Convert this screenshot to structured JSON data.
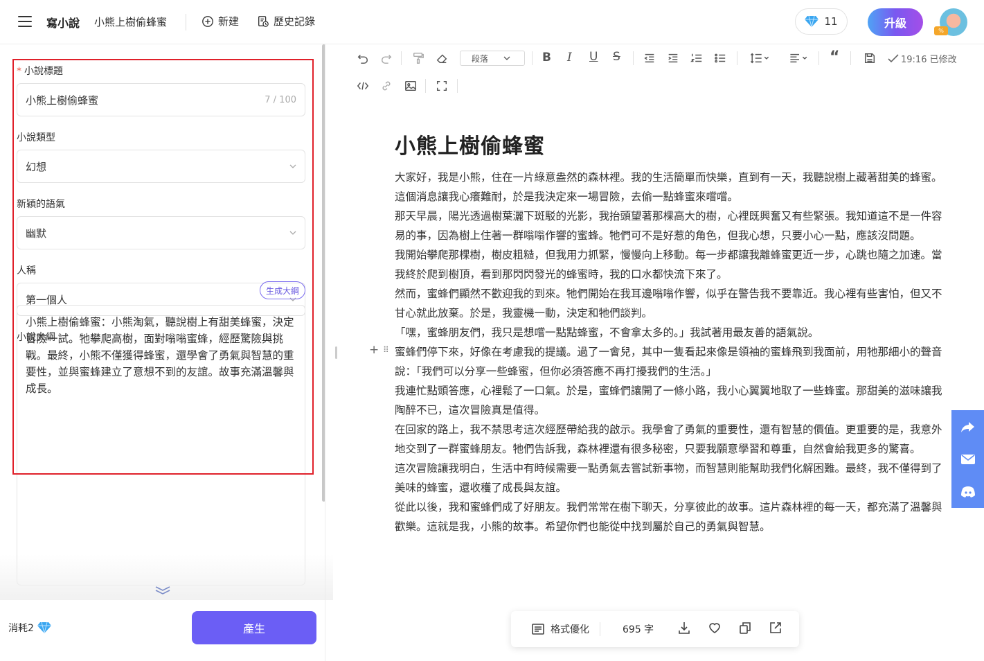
{
  "topbar": {
    "app_title": "寫小說",
    "doc_name": "小熊上樹偷蜂蜜",
    "new_label": "新建",
    "history_label": "歷史記錄",
    "gem_count": "11",
    "upgrade_label": "升級",
    "avatar_badge": "%"
  },
  "form": {
    "title_label": "小說標題",
    "title_value": "小熊上樹偷蜂蜜",
    "title_counter": "7 / 100",
    "genre_label": "小說類型",
    "genre_value": "幻想",
    "tone_label": "新穎的語氣",
    "tone_value": "幽默",
    "pov_label": "人稱",
    "pov_value": "第一個人",
    "outline_label": "小說大綱",
    "outline_button": "生成大綱",
    "outline_text": "小熊上樹偷蜂蜜：小熊淘氣，聽說樹上有甜美蜂蜜，決定冒險一試。牠攀爬高樹，面對嗡嗡蜜蜂，經歷驚險與挑戰。最終，小熊不僅獲得蜂蜜，還學會了勇氣與智慧的重要性，並與蜜蜂建立了意想不到的友誼。故事充滿溫馨與成長。",
    "cost_label": "消耗2",
    "generate_label": "產生"
  },
  "toolbar": {
    "paragraph_select": "段落",
    "saved_status": "19:16 已修改"
  },
  "document": {
    "title": "小熊上樹偷蜂蜜",
    "paragraphs": [
      "大家好，我是小熊，住在一片綠意盎然的森林裡。我的生活簡單而快樂，直到有一天，我聽說樹上藏著甜美的蜂蜜。這個消息讓我心癢難耐，於是我決定來一場冒險，去偷一點蜂蜜來嚐嚐。",
      "那天早晨，陽光透過樹葉灑下斑駁的光影，我抬頭望著那棵高大的樹，心裡既興奮又有些緊張。我知道這不是一件容易的事，因為樹上住著一群嗡嗡作響的蜜蜂。牠們可不是好惹的角色，但我心想，只要小心一點，應該沒問題。",
      "我開始攀爬那棵樹，樹皮粗糙，但我用力抓緊，慢慢向上移動。每一步都讓我離蜂蜜更近一步，心跳也隨之加速。當我終於爬到樹頂，看到那閃閃發光的蜂蜜時，我的口水都快流下來了。",
      "然而，蜜蜂們顯然不歡迎我的到來。牠們開始在我耳邊嗡嗡作響，似乎在警告我不要靠近。我心裡有些害怕，但又不甘心就此放棄。於是，我靈機一動，決定和牠們談判。",
      "「嘿，蜜蜂朋友們，我只是想嚐一點點蜂蜜，不會拿太多的。」我試著用最友善的語氣說。",
      "蜜蜂們停下來，好像在考慮我的提議。過了一會兒，其中一隻看起來像是領袖的蜜蜂飛到我面前，用牠那細小的聲音說：「我們可以分享一些蜂蜜，但你必須答應不再打擾我們的生活。」",
      "我連忙點頭答應，心裡鬆了一口氣。於是，蜜蜂們讓開了一條小路，我小心翼翼地取了一些蜂蜜。那甜美的滋味讓我陶醉不已，這次冒險真是值得。",
      "在回家的路上，我不禁思考這次經歷帶給我的啟示。我學會了勇氣的重要性，還有智慧的價值。更重要的是，我意外地交到了一群蜜蜂朋友。牠們告訴我，森林裡還有很多秘密，只要我願意學習和尊重，自然會給我更多的驚喜。",
      "這次冒險讓我明白，生活中有時候需要一點勇氣去嘗試新事物，而智慧則能幫助我們化解困難。最終，我不僅得到了美味的蜂蜜，還收穫了成長與友誼。",
      "從此以後，我和蜜蜂們成了好朋友。我們常常在樹下聊天，分享彼此的故事。這片森林裡的每一天，都充滿了溫馨與歡樂。這就是我，小熊的故事。希望你們也能從中找到屬於自己的勇氣與智慧。"
    ]
  },
  "floatbar": {
    "format_label": "格式優化",
    "word_count": "695 字"
  },
  "colors": {
    "accent": "#6b5ef5",
    "side_rail": "#5f8cf5",
    "highlight_frame": "#e0202a"
  }
}
